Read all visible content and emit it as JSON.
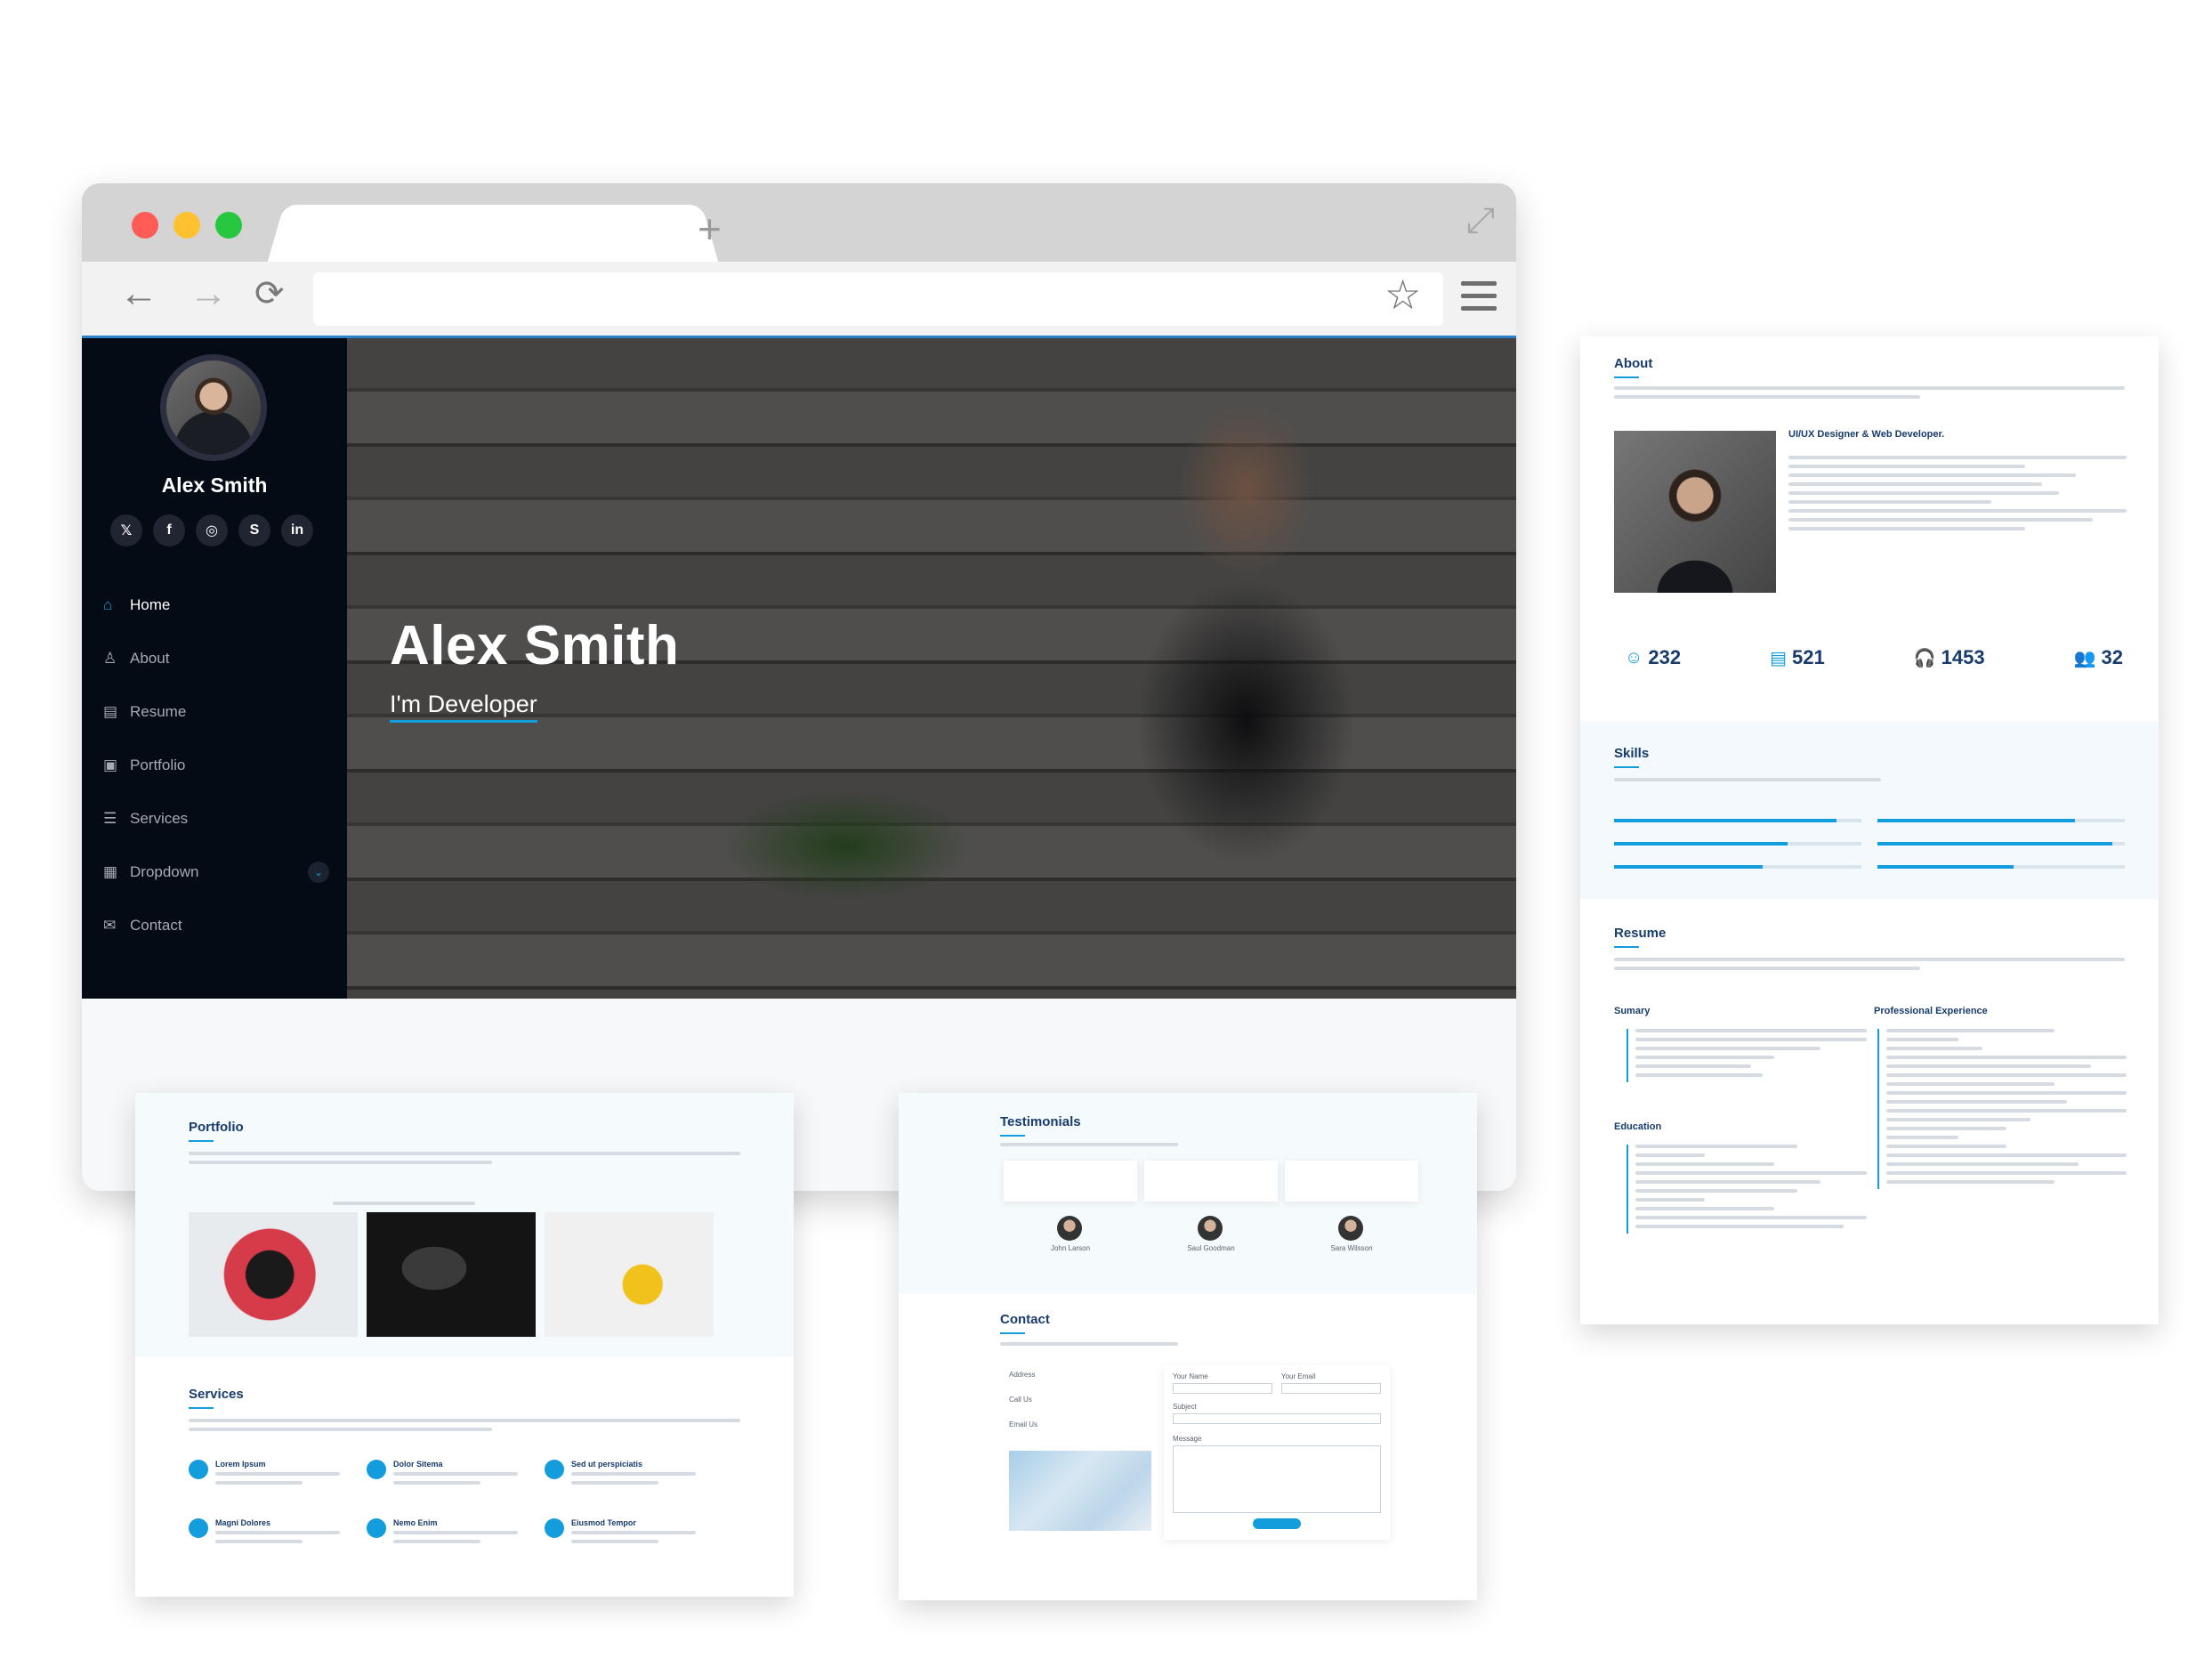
{
  "browser": {
    "new_tab_symbol": "+",
    "back_symbol": "←",
    "forward_symbol": "→",
    "reload_symbol": "⟳",
    "bookmark_symbol": "☆",
    "expand_symbol": "⤢"
  },
  "sidebar": {
    "name": "Alex Smith",
    "socials": [
      {
        "icon": "x-icon",
        "glyph": "𝕏"
      },
      {
        "icon": "facebook-icon",
        "glyph": "f"
      },
      {
        "icon": "instagram-icon",
        "glyph": "◎"
      },
      {
        "icon": "skype-icon",
        "glyph": "S"
      },
      {
        "icon": "linkedin-icon",
        "glyph": "in"
      }
    ],
    "items": [
      {
        "label": "Home",
        "icon": "house-icon",
        "glyph": "⌂"
      },
      {
        "label": "About",
        "icon": "person-icon",
        "glyph": "♙"
      },
      {
        "label": "Resume",
        "icon": "file-icon",
        "glyph": "▤"
      },
      {
        "label": "Portfolio",
        "icon": "images-icon",
        "glyph": "▣"
      },
      {
        "label": "Services",
        "icon": "hdd-stack-icon",
        "glyph": "☰"
      },
      {
        "label": "Dropdown",
        "icon": "menu-app-icon",
        "glyph": "▦",
        "chevron": "⌄"
      },
      {
        "label": "Contact",
        "icon": "envelope-icon",
        "glyph": "✉"
      }
    ]
  },
  "hero": {
    "title": "Alex Smith",
    "subtitle": "I'm Developer"
  },
  "about_page": {
    "title": "About",
    "role": "UI/UX Designer & Web Developer.",
    "counters": [
      {
        "value": "232",
        "icon": "emoji-smile-icon",
        "glyph": "☺"
      },
      {
        "value": "521",
        "icon": "journal-icon",
        "glyph": "▤"
      },
      {
        "value": "1453",
        "icon": "headset-icon",
        "glyph": "🎧"
      },
      {
        "value": "32",
        "icon": "people-icon",
        "glyph": "👥"
      }
    ],
    "skills_title": "Skills",
    "skills_levels": [
      0.9,
      0.8,
      0.7,
      0.95,
      0.6,
      0.55
    ],
    "resume_title": "Resume",
    "resume_left": [
      "Sumary",
      "Education"
    ],
    "resume_right": [
      "Professional Experience"
    ]
  },
  "portfolio_page": {
    "title": "Portfolio",
    "services_title": "Services",
    "services": [
      "Lorem Ipsum",
      "Dolor Sitema",
      "Sed ut perspiciatis",
      "Magni Dolores",
      "Nemo Enim",
      "Eiusmod Tempor"
    ]
  },
  "testimonials_page": {
    "title": "Testimonials",
    "people": [
      "John Larson",
      "Saul Goodman",
      "Sara Wilsson"
    ],
    "contact_title": "Contact",
    "info": [
      "Address",
      "Call Us",
      "Email Us"
    ],
    "form_labels": [
      "Your Name",
      "Your Email",
      "Subject",
      "Message"
    ]
  }
}
